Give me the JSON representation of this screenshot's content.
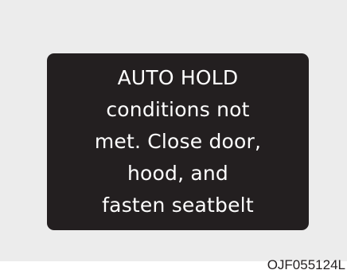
{
  "display": {
    "message_lines": [
      "AUTO HOLD",
      "conditions not",
      "met. Close door,",
      "hood, and",
      "fasten seatbelt"
    ]
  },
  "figure_code": "OJF055124L",
  "colors": {
    "page_background": "#ffffff",
    "panel_background": "#ececec",
    "display_background": "#231f20",
    "display_text": "#ffffff"
  }
}
